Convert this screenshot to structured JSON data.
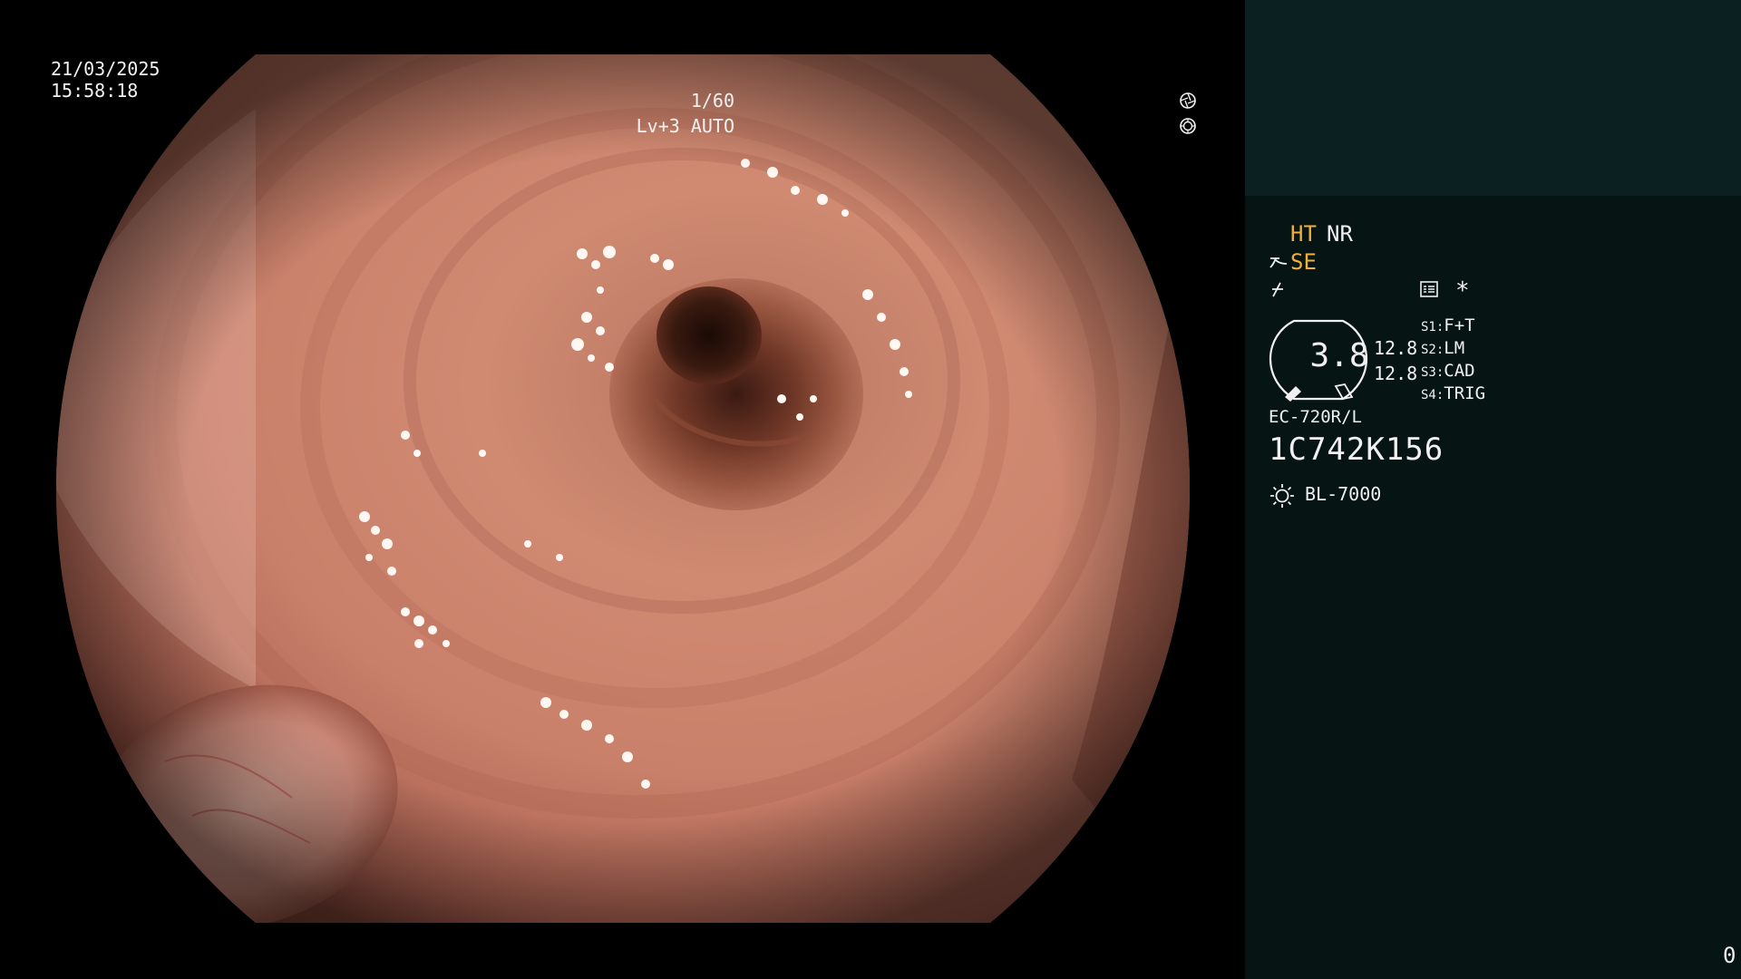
{
  "overlay": {
    "date": "21/03/2025",
    "time": "15:58:18",
    "shutter": "1/60",
    "level": "Lv+3 AUTO"
  },
  "panel": {
    "ht_label": "HT",
    "nr_label": "NR",
    "se_label": "SE",
    "asterisk": "*",
    "ring_value": "3.8",
    "value_a": "12.8",
    "value_b": "12.8",
    "settings": [
      {
        "key": "S1:",
        "value": "F+T"
      },
      {
        "key": "S2:",
        "value": "LM"
      },
      {
        "key": "S3:",
        "value": "CAD"
      },
      {
        "key": "S4:",
        "value": "TRIG"
      }
    ],
    "scope_model": "EC-720R/L",
    "serial": "1C742K156",
    "light_source": "BL-7000",
    "frame_count": "0"
  },
  "colors": {
    "panel_bg": "#071414",
    "panel_top_bg": "#0b2020",
    "accent_orange": "#f2b134",
    "text": "#f0f0f0"
  },
  "icons": {
    "shutter": "aperture-icon",
    "auto": "auto-iris-icon",
    "structure_enhance": "se-mode-icon",
    "color_mode": "color-mode-icon",
    "menu": "menu-list-icon",
    "ring": "ring-gauge-icon",
    "light": "sun-icon"
  }
}
